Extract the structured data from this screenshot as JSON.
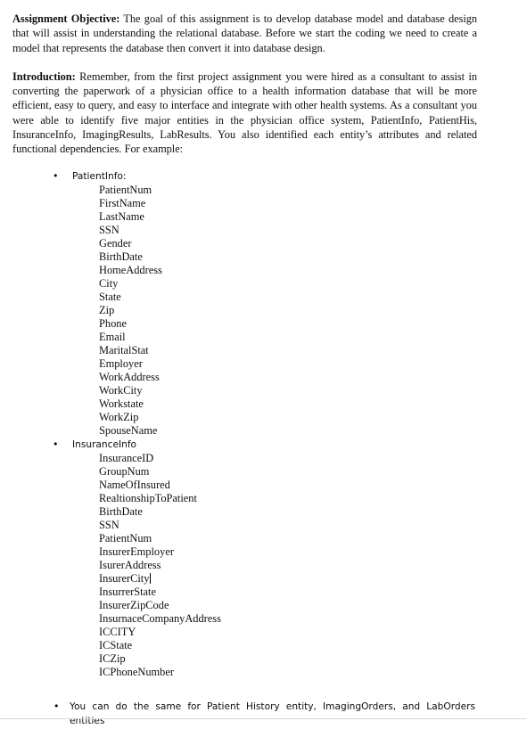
{
  "document": {
    "assignment_objective": {
      "lead": "Assignment  Objective:",
      "text": "  The goal of this assignment is to develop database model and database design that will assist in understanding the relational database. Before we  start the coding we need to create a model that represents the database then convert it into database design."
    },
    "introduction": {
      "lead": "Introduction:",
      "text": "  Remember,  from the first project assignment you were hired as a consultant to assist in converting the paperwork of a physician office to a health information database that will be more  efficient, easy to query, and easy to interface and integrate with other health systems. As a consultant you were able to identify five major entities in the physician office system, PatientInfo, PatientHis, InsuranceInfo, ImagingResults, LabResults.  You also identified each entity’s attributes and related functional dependencies. For example:"
    },
    "bullet_glyph": "•",
    "entities": [
      {
        "name": "PatientInfo:",
        "attributes": [
          "PatientNum",
          "FirstName",
          "LastName",
          "SSN",
          "Gender",
          "BirthDate",
          "HomeAddress",
          "City",
          "State",
          "Zip",
          "Phone",
          "Email",
          "MaritalStat",
          "Employer",
          "WorkAddress",
          "WorkCity",
          "Workstate",
          "WorkZip",
          "SpouseName"
        ],
        "caret_after_index": -1
      },
      {
        "name": "InsuranceInfo",
        "attributes": [
          "InsuranceID",
          "GroupNum",
          "NameOfInsured",
          "RealtionshipToPatient",
          "BirthDate",
          "SSN",
          "PatientNum",
          "InsurerEmployer",
          "IsurerAddress",
          "InsurerCity",
          "InsurrerState",
          "InsurerZipCode",
          "InsurnaceCompanyAddress",
          "ICCITY",
          "ICState",
          "ICZip",
          "ICPhoneNumber"
        ],
        "caret_after_index": 9
      }
    ],
    "final_bullet": "You can do the same for Patient History entity, ImagingOrders, and LabOrders entities"
  }
}
